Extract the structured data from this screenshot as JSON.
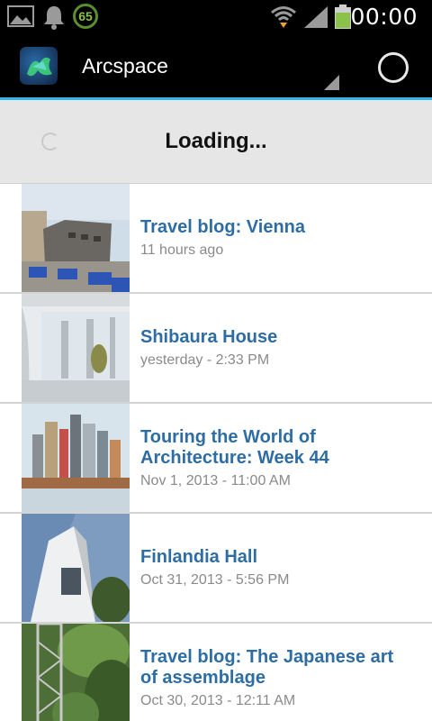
{
  "status_bar": {
    "time": "00:00",
    "notification_badge": "65",
    "icons": [
      "gallery-icon",
      "bell-icon",
      "wifi-icon",
      "signal-icon",
      "battery-icon"
    ],
    "battery_color": "#8bc34a"
  },
  "action_bar": {
    "title": "Arcspace",
    "accent_color": "#33b5e5"
  },
  "loading": {
    "text": "Loading..."
  },
  "articles": [
    {
      "title": "Travel blog: Vienna",
      "date": "11 hours ago"
    },
    {
      "title": "Shibaura House",
      "date": "yesterday - 2:33 PM"
    },
    {
      "title": "Touring the World of Architecture: Week 44",
      "date": "Nov 1, 2013 - 11:00 AM"
    },
    {
      "title": "Finlandia Hall",
      "date": "Oct 31, 2013 - 5:56 PM"
    },
    {
      "title": "Travel blog: The Japanese art of assemblage",
      "date": "Oct 30, 2013 - 12:11 AM"
    }
  ]
}
